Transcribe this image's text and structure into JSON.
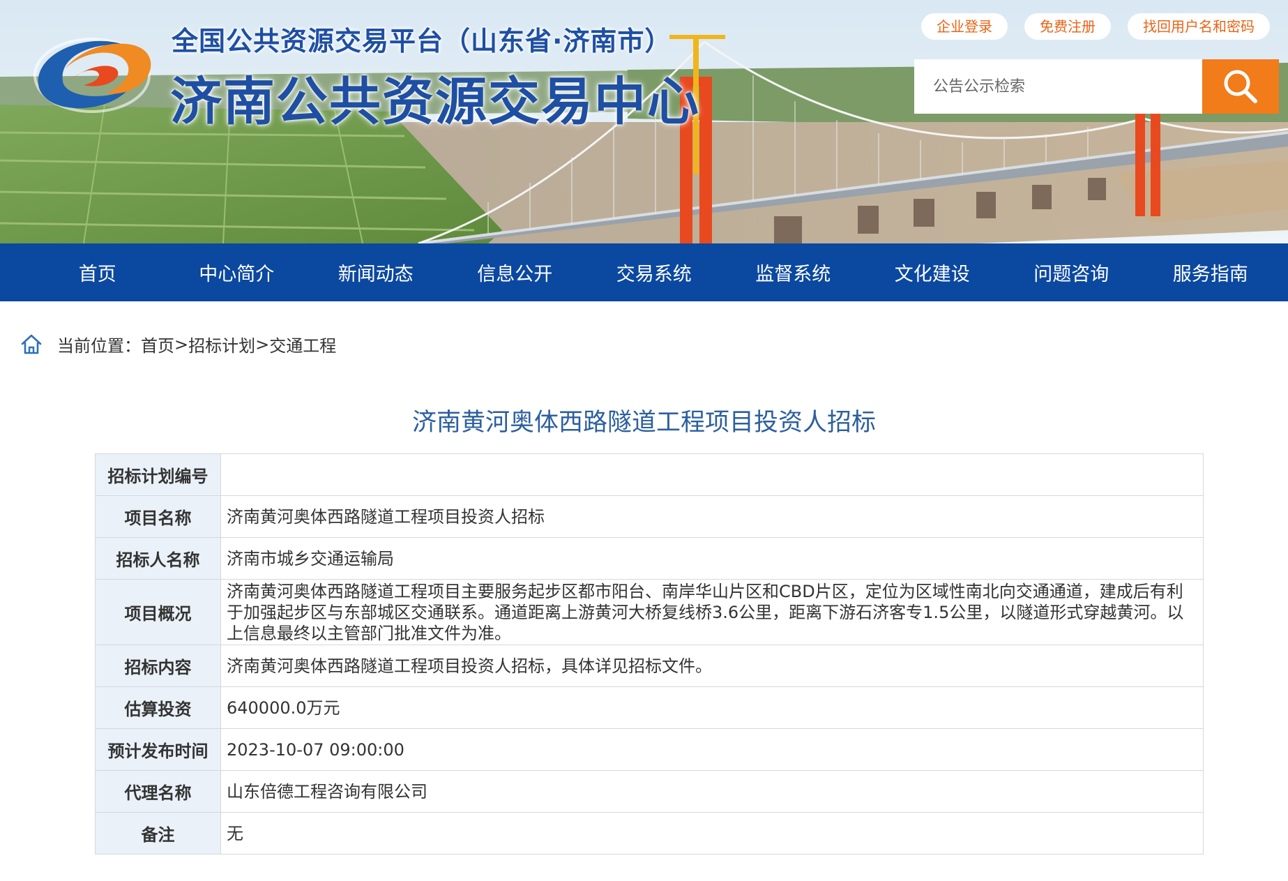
{
  "header": {
    "platform_title": "全国公共资源交易平台（山东省·济南市）",
    "center_title": "济南公共资源交易中心",
    "links": [
      "企业登录",
      "免费注册",
      "找回用户名和密码"
    ],
    "search": {
      "placeholder": "公告公示检索"
    }
  },
  "nav": {
    "items": [
      "首页",
      "中心简介",
      "新闻动态",
      "信息公开",
      "交易系统",
      "监督系统",
      "文化建设",
      "问题咨询",
      "服务指南"
    ]
  },
  "breadcrumb": {
    "prefix": "当前位置：",
    "items": [
      "首页",
      "招标计划",
      "交通工程"
    ],
    "separator": ">"
  },
  "page_title": "济南黄河奥体西路隧道工程项目投资人招标",
  "table": {
    "rows": [
      {
        "label": "招标计划编号",
        "value": ""
      },
      {
        "label": "项目名称",
        "value": "济南黄河奥体西路隧道工程项目投资人招标"
      },
      {
        "label": "招标人名称",
        "value": "济南市城乡交通运输局"
      },
      {
        "label": "项目概况",
        "value": "济南黄河奥体西路隧道工程项目主要服务起步区都市阳台、南岸华山片区和CBD片区，定位为区域性南北向交通通道，建成后有利于加强起步区与东部城区交通联系。通道距离上游黄河大桥复线桥3.6公里，距离下游石济客专1.5公里，以隧道形式穿越黄河。以上信息最终以主管部门批准文件为准。"
      },
      {
        "label": "招标内容",
        "value": "济南黄河奥体西路隧道工程项目投资人招标，具体详见招标文件。"
      },
      {
        "label": "估算投资",
        "value": "640000.0万元"
      },
      {
        "label": "预计发布时间",
        "value": "2023-10-07 09:00:00"
      },
      {
        "label": "代理名称",
        "value": "山东倍德工程咨询有限公司"
      },
      {
        "label": "备注",
        "value": "无"
      }
    ]
  },
  "colors": {
    "nav_blue": "#0b48a0",
    "accent_orange": "#f27b1a",
    "title_blue": "#2c5f9e",
    "label_bg": "#eaf1f8"
  },
  "icons": {
    "search_button": "search-icon",
    "breadcrumb": "home-icon",
    "logo": "logo-icon"
  }
}
